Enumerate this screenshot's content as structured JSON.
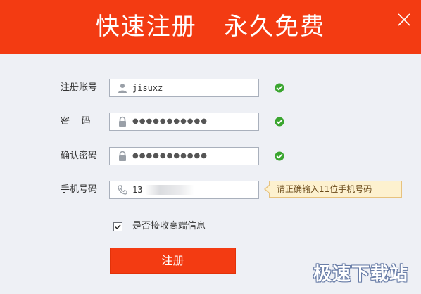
{
  "header": {
    "title": "快速注册   永久免费",
    "background_color": "#f33b12",
    "close_icon": "close-icon"
  },
  "form": {
    "fields": [
      {
        "label": "注册账号",
        "icon": "user-icon",
        "value": "jisuxz",
        "status": "valid",
        "status_icon": "check-circle-icon"
      },
      {
        "label": "密    码",
        "icon": "lock-icon",
        "value": "●●●●●●●●●●●",
        "status": "valid",
        "status_icon": "check-circle-icon"
      },
      {
        "label": "确认密码",
        "icon": "lock-icon",
        "value": "●●●●●●●●●●●",
        "status": "valid",
        "status_icon": "check-circle-icon"
      },
      {
        "label": "手机号码",
        "icon": "phone-icon",
        "value": "13",
        "status": "error"
      }
    ],
    "phone_error_tooltip": "请正确输入11位手机号码",
    "agree": {
      "checked": true,
      "label": "是否接收高端信息"
    },
    "submit_label": "注册"
  },
  "watermark": "极速下载站",
  "colors": {
    "accent": "#f33b12",
    "valid": "#3aa52f",
    "tooltip_bg": "#fdf1cf",
    "tooltip_border": "#e7c27e"
  }
}
